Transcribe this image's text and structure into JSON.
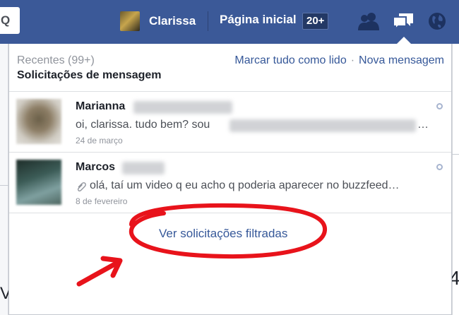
{
  "header": {
    "search_glyph": "Q",
    "profile_name": "Clarissa",
    "home_label": "Página inicial",
    "home_badge": "20+",
    "icons": [
      "friends-icon",
      "messages-icon",
      "globe-icon"
    ]
  },
  "background": {
    "right_partial_digit": "4",
    "left_partial_digit": "V"
  },
  "panel": {
    "recent_label": "Recentes (99+)",
    "title": "Solicitações de mensagem",
    "mark_all_read": "Marcar tudo como lido",
    "separator": "·",
    "new_message": "Nova mensagem",
    "messages": [
      {
        "name": "Marianna",
        "preview": "oi, clarissa. tudo bem? sou",
        "preview_tail": "…",
        "date": "24 de março",
        "has_attachment": false
      },
      {
        "name": "Marcos",
        "preview": "olá, taí um video q eu acho q poderia aparecer no buzzfeed…",
        "date": "8 de fevereiro",
        "has_attachment": true
      }
    ],
    "filtered_link": "Ver solicitações filtradas"
  },
  "colors": {
    "topbar": "#3b5998",
    "link": "#365899",
    "annotation": "#e8131b"
  }
}
